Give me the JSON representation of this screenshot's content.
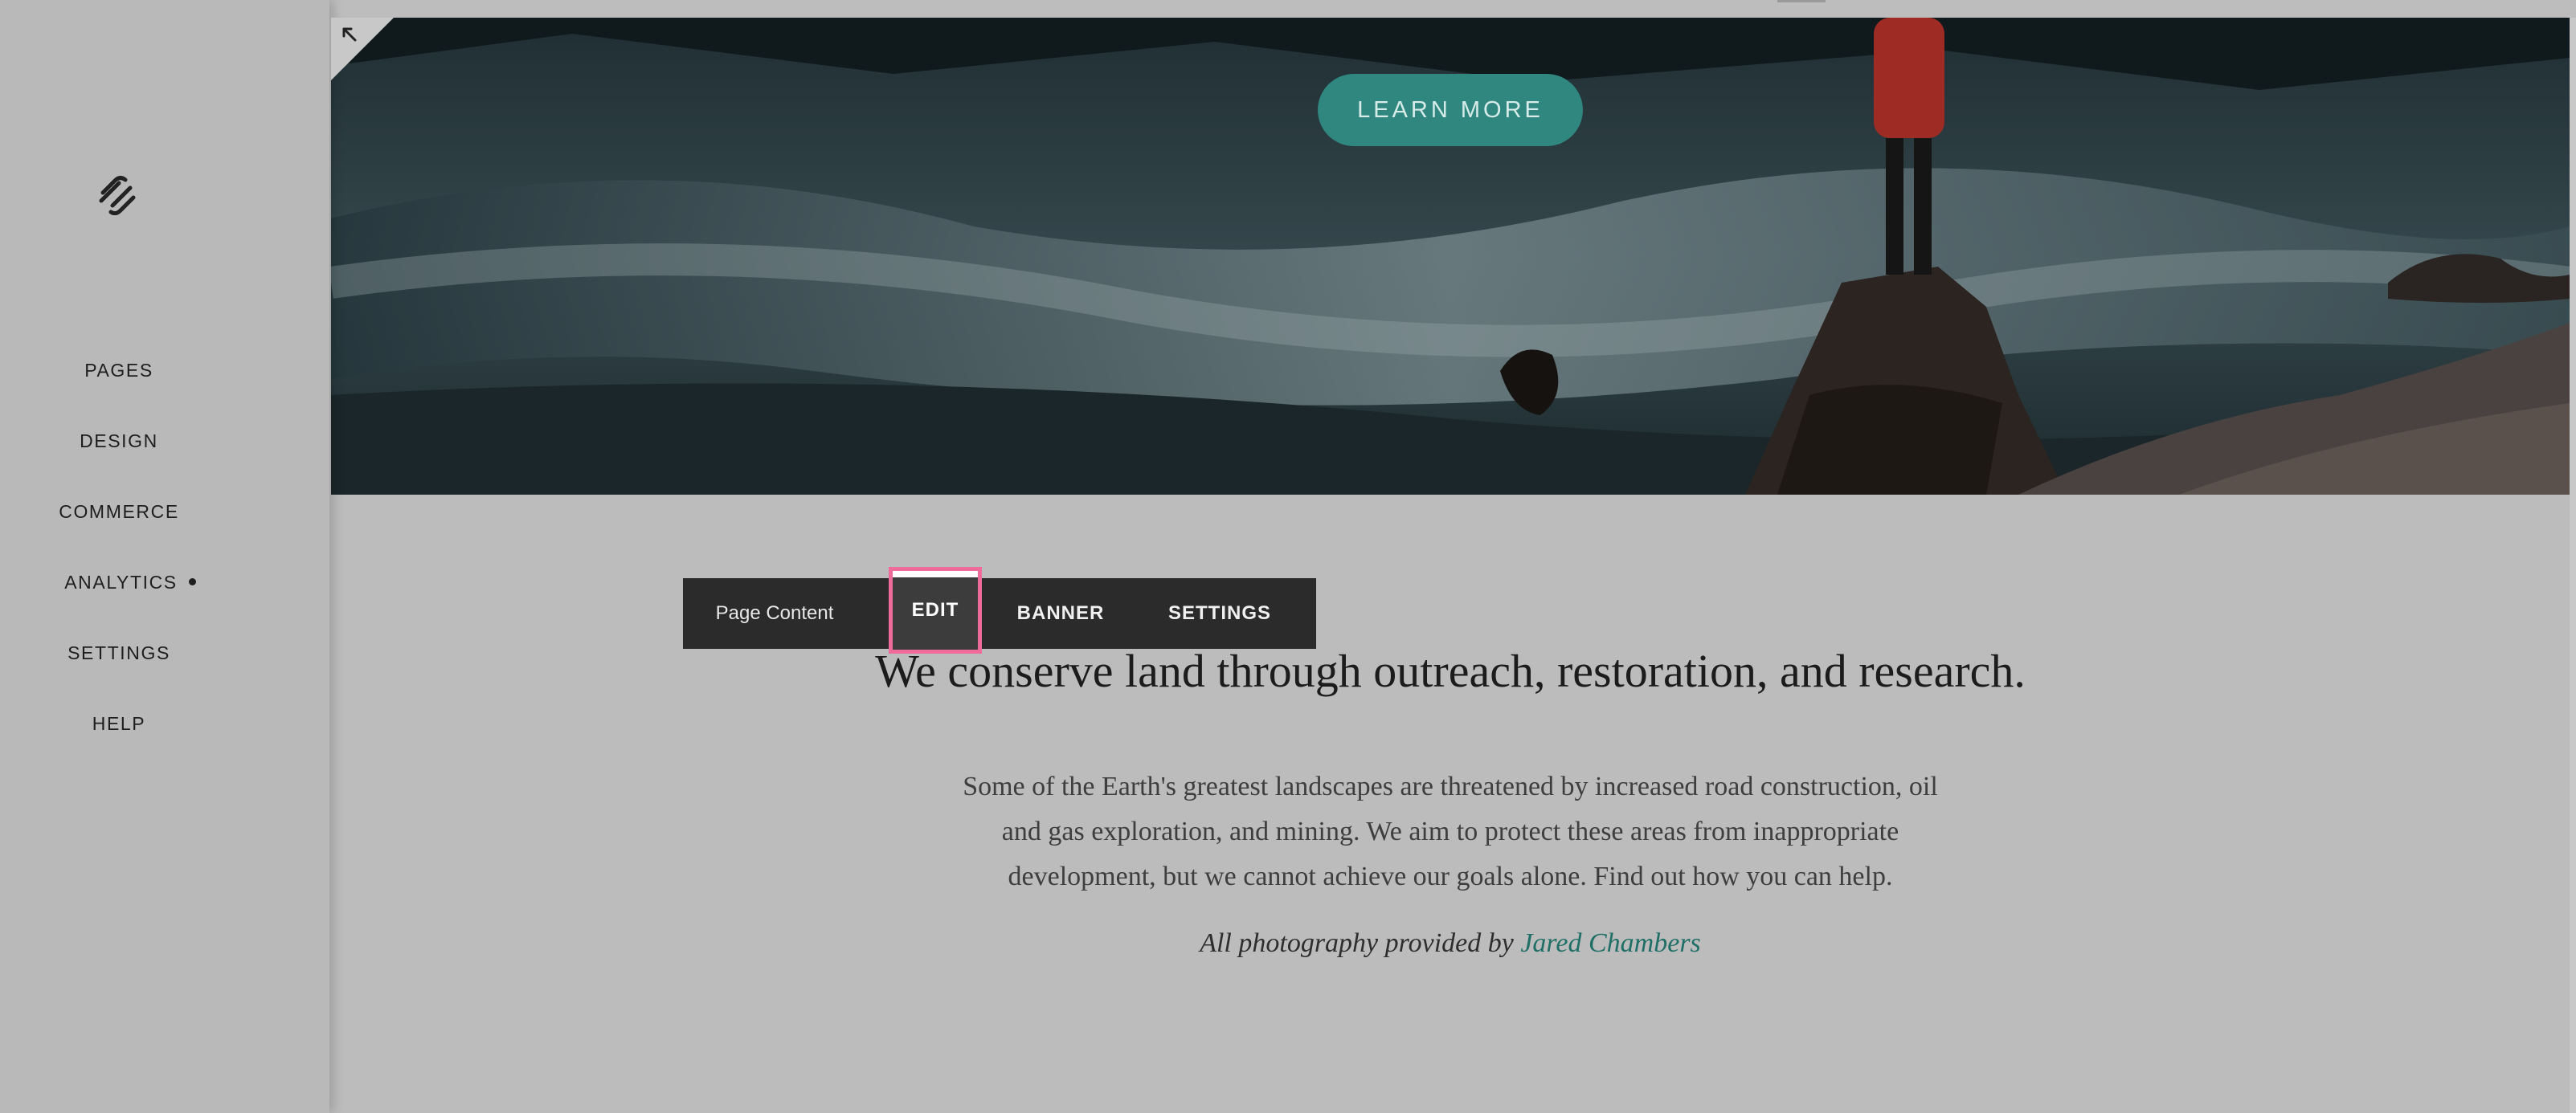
{
  "sidebar": {
    "logo_icon": "squarespace-logo-icon",
    "items": [
      {
        "label": "PAGES"
      },
      {
        "label": "DESIGN"
      },
      {
        "label": "COMMERCE"
      },
      {
        "label": "ANALYTICS"
      },
      {
        "label": "SETTINGS"
      },
      {
        "label": "HELP"
      }
    ]
  },
  "hero": {
    "cta_label": "LEARN MORE",
    "collapse_icon": "arrow-up-left-icon"
  },
  "toolbar": {
    "page_content_label": "Page Content",
    "edit_label": "EDIT",
    "banner_label": "BANNER",
    "settings_label": "SETTINGS"
  },
  "content": {
    "heading": "We conserve land through outreach, restoration, and research.",
    "paragraph_line1": "Some of the Earth's greatest landscapes are threatened by increased road construction, oil",
    "paragraph_line2": "and gas exploration, and mining. We aim to protect these areas from inappropriate",
    "paragraph_line3": "development, but we cannot achieve our goals alone. Find out how you can help.",
    "credit_prefix": "All photography provided by",
    "credit_link": "Jared Chambers"
  },
  "colors": {
    "accent_teal": "#2f877f",
    "highlight_pink": "#f06a9a",
    "toolbar_bg": "#2b2b2b"
  }
}
